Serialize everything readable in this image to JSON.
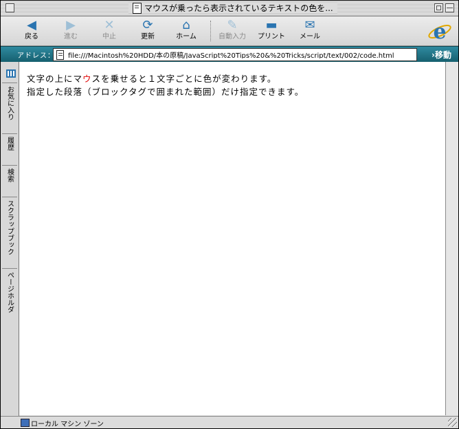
{
  "window": {
    "title": "マウスが乗ったら表示されているテキストの色を..."
  },
  "toolbar": {
    "back": "戻る",
    "forward": "進む",
    "stop": "中止",
    "refresh": "更新",
    "home": "ホーム",
    "autofill": "自動入力",
    "print": "プリント",
    "mail": "メール"
  },
  "address": {
    "label": "アドレス：",
    "url": "file:///Macintosh%20HDD/本の原稿/JavaScript%20Tips%20&%20Tricks/script/text/002/code.html",
    "go": "›移動"
  },
  "sidebar": {
    "tabs": [
      "お気に入り",
      "履歴",
      "検索",
      "スクラップブック",
      "ページホルダ"
    ]
  },
  "content": {
    "line1_pre": "文字の上に",
    "line1_ma": "マ",
    "line1_u": "ウ",
    "line1_su": "ス",
    "line1_post": "を乗せると１文字ごとに色が変わります。",
    "line2": "指定した段落（ブロックタグで囲まれた範囲）だけ指定できます。"
  },
  "status": {
    "text": "ローカル マシン ゾーン"
  },
  "colors": {
    "highlight": "#e00000",
    "address_bar": "#1f7486",
    "icon_blue": "#2a74b0"
  }
}
